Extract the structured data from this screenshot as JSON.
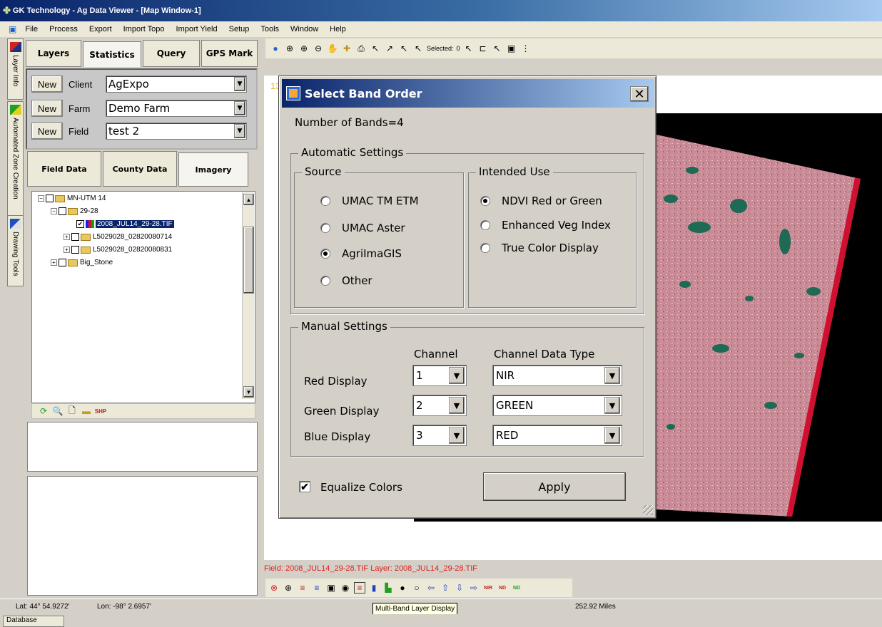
{
  "app": {
    "title": "GK Technology - Ag Data Viewer - [Map Window-1]"
  },
  "menu": [
    "File",
    "Process",
    "Export",
    "Import Topo",
    "Import Yield",
    "Setup",
    "Tools",
    "Window",
    "Help"
  ],
  "side_tabs": [
    "Layer Info",
    "Automated Zone Creation",
    "Drawing Tools"
  ],
  "left_tabs": {
    "layers": "Layers",
    "statistics": "Statistics",
    "query": "Query",
    "gps": "GPS Mark"
  },
  "cff": {
    "new_label": "New",
    "client_label": "Client",
    "client_value": "AgExpo",
    "farm_label": "Farm",
    "farm_value": "Demo Farm",
    "field_label": "Field",
    "field_value": "test 2"
  },
  "data_tabs": {
    "field": "Field Data",
    "county": "County Data",
    "imagery": "Imagery"
  },
  "tree": {
    "n0": "MN-UTM 14",
    "n1": "29-28",
    "n2": "2008_JUL14_29-28.TIF",
    "n3": "L5029028_02820080714",
    "n4": "L5029028_02820080831",
    "n5": "Big_Stone"
  },
  "map_toolbar": {
    "selected_label": "Selected:",
    "selected_count": "0"
  },
  "map_label_partial": "13",
  "field_status": "Field: 2008_JUL14_29-28.TIF Layer: 2008_JUL14_29-28.TIF",
  "status": {
    "lat": "Lat: 44° 54.9272'",
    "lon": "Lon: -98° 2.6957'",
    "distance": "252.92 Miles"
  },
  "tooltip": "Multi-Band Layer Display",
  "database_tab": "Database",
  "dialog": {
    "title": "Select Band Order",
    "bands": "Number of Bands=4",
    "auto_group": "Automatic Settings",
    "source_group": "Source",
    "source_options": [
      "UMAC TM ETM",
      "UMAC Aster",
      "AgriImaGIS",
      "Other"
    ],
    "source_selected": "AgriImaGIS",
    "use_group": "Intended Use",
    "use_options": [
      "NDVI Red or Green",
      "Enhanced Veg Index",
      "True Color Display"
    ],
    "use_selected": "NDVI Red or Green",
    "manual_group": "Manual Settings",
    "col_channel": "Channel",
    "col_type": "Channel Data Type",
    "rows": [
      {
        "label": "Red Display",
        "channel": "1",
        "type": "NIR"
      },
      {
        "label": "Green Display",
        "channel": "2",
        "type": "GREEN"
      },
      {
        "label": "Blue Display",
        "channel": "3",
        "type": "RED"
      }
    ],
    "equalize_label": "Equalize Colors",
    "equalize_checked": true,
    "apply_label": "Apply"
  },
  "colors": {
    "title_dark": "#0a246a",
    "field_text": "#e02020",
    "image_pink": "#c98a96",
    "water": "#1f6a55"
  }
}
